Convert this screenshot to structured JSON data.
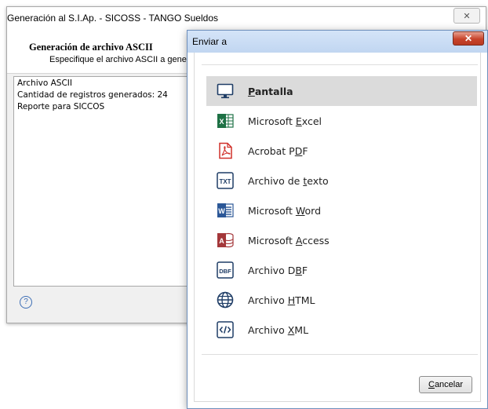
{
  "background_window": {
    "title": "Generación al S.I.Ap. - SICOSS - TANGO Sueldos",
    "close_glyph": "✕",
    "header_title": "Generación de archivo ASCII",
    "header_subtitle": "Especifique el archivo ASCII a generar.",
    "lines": [
      "Archivo ASCII",
      "Cantidad de registros generados: 24",
      "Reporte para SICCOS"
    ],
    "help_glyph": "?"
  },
  "dialog": {
    "title": "Enviar a",
    "close_glyph": "✕",
    "options": [
      {
        "pre": "",
        "u": "P",
        "post": "antalla",
        "icon": "monitor-icon",
        "selected": true
      },
      {
        "pre": "Microsoft ",
        "u": "E",
        "post": "xcel",
        "icon": "excel-icon",
        "selected": false
      },
      {
        "pre": "Acrobat P",
        "u": "D",
        "post": "F",
        "icon": "pdf-icon",
        "selected": false
      },
      {
        "pre": "Archivo de ",
        "u": "t",
        "post": "exto",
        "icon": "txt-icon",
        "selected": false
      },
      {
        "pre": "Microsoft ",
        "u": "W",
        "post": "ord",
        "icon": "word-icon",
        "selected": false
      },
      {
        "pre": "Microsoft ",
        "u": "A",
        "post": "ccess",
        "icon": "access-icon",
        "selected": false
      },
      {
        "pre": "Archivo D",
        "u": "B",
        "post": "F",
        "icon": "dbf-icon",
        "selected": false
      },
      {
        "pre": "Archivo ",
        "u": "H",
        "post": "TML",
        "icon": "globe-icon",
        "selected": false
      },
      {
        "pre": "Archivo ",
        "u": "X",
        "post": "ML",
        "icon": "xml-code-icon",
        "selected": false
      }
    ],
    "cancel": {
      "u": "C",
      "post": "ancelar"
    }
  },
  "colors": {
    "excel": "#1e7145",
    "pdf": "#d0302a",
    "word": "#2b5797",
    "access": "#a4373a",
    "outline_blue": "#1f3d66"
  }
}
